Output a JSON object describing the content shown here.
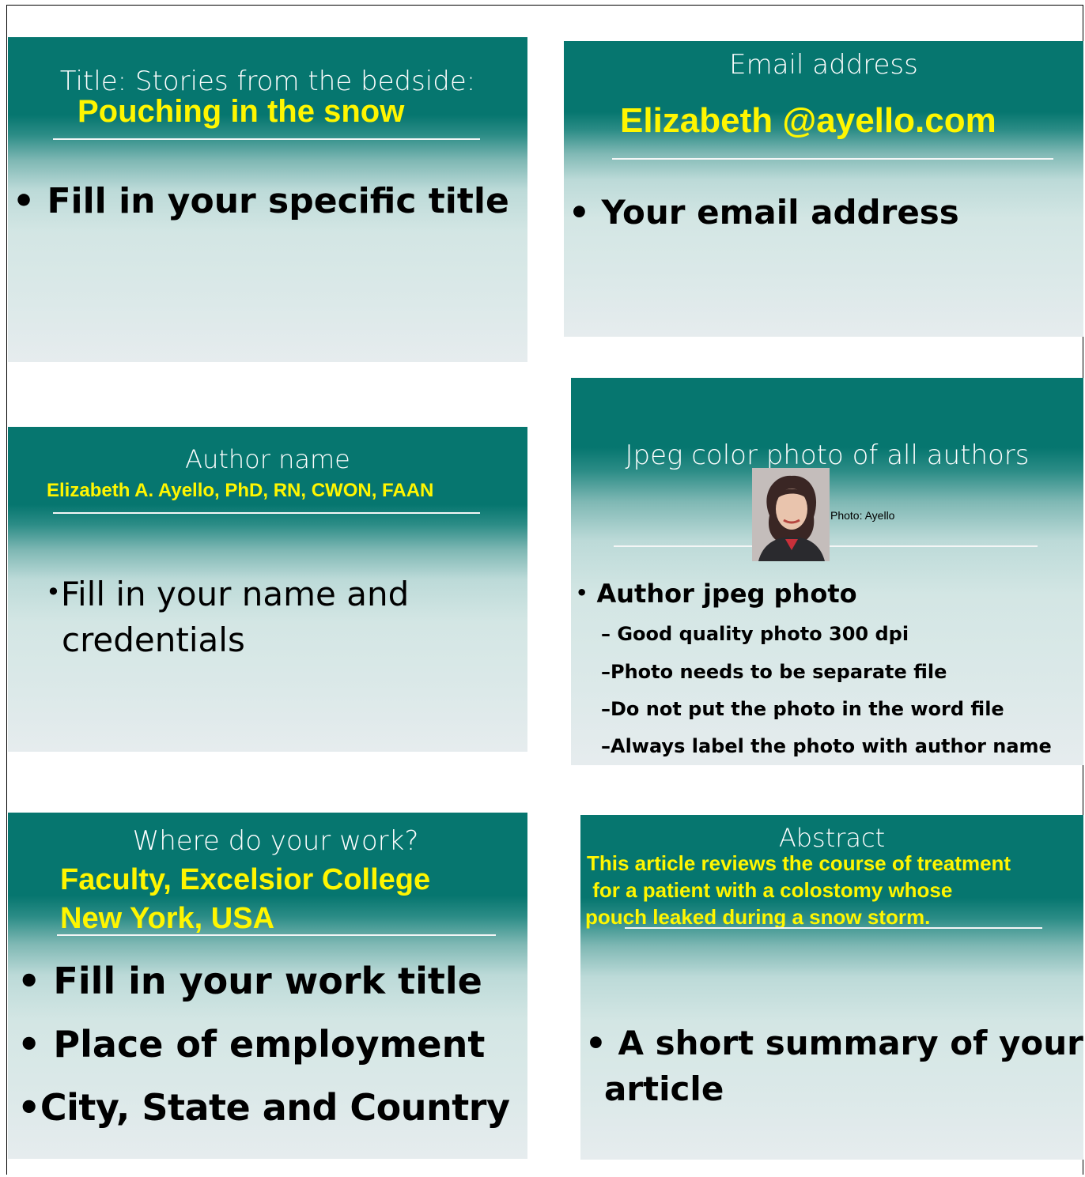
{
  "slides": {
    "title": {
      "heading": "Title: Stories from the bedside:",
      "highlight": "Pouching in the snow",
      "bullet": "Fill in your specific title"
    },
    "email": {
      "heading": "Email address",
      "highlight": "Elizabeth @ayello.com",
      "bullet": "Your email address"
    },
    "author": {
      "heading": "Author name",
      "highlight": "Elizabeth A. Ayello, PhD, RN, CWON, FAAN",
      "bullet_line1": "Fill in your name and",
      "bullet_line2": "credentials"
    },
    "photo": {
      "heading": "Jpeg color photo of all authors",
      "caption": "Photo: Ayello",
      "bullet": "Author jpeg photo",
      "subs": [
        "Good quality photo 300 dpi",
        "Photo needs to be separate file",
        "Do not put the photo in the word file",
        "Always label the photo with author name"
      ]
    },
    "work": {
      "heading": "Where do your work?",
      "highlight_line1": "Faculty, Excelsior College",
      "highlight_line2": "New York, USA",
      "bullets": [
        "Fill in your work title",
        "Place of employment",
        "City, State and Country"
      ]
    },
    "abstract": {
      "heading": "Abstract",
      "highlight_lines": [
        "This article reviews the course of treatment",
        " for a patient with a colostomy whose",
        "pouch leaked during a snow storm."
      ],
      "bullet_line1": "A short summary of your",
      "bullet_line2": "article"
    }
  },
  "bullet_char": "•",
  "dash_char": "–"
}
